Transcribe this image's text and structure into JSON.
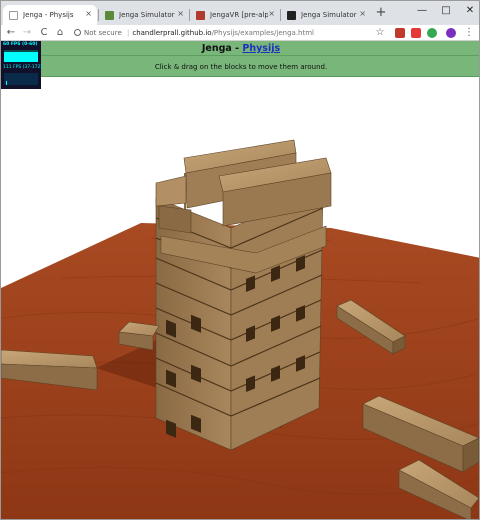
{
  "browser": {
    "tabs": [
      {
        "label": "Jenga - Physijs",
        "active": true,
        "favicon_color": "#f1f3f4"
      },
      {
        "label": "Jenga Simulator by ch",
        "active": false,
        "favicon_color": "#5b8a3c"
      },
      {
        "label": "JengaVR [pre-alpha] b",
        "active": false,
        "favicon_color": "#b03a2e"
      },
      {
        "label": "Jenga Simulator by Br",
        "active": false,
        "favicon_color": "#222222"
      }
    ],
    "close_glyph": "×",
    "new_tab_glyph": "+",
    "window_controls": {
      "minimize": "—",
      "maximize": "□",
      "close": "✕"
    },
    "nav": {
      "back": "←",
      "forward": "→",
      "reload": "C",
      "home": "⌂"
    },
    "address": {
      "security": "Not secure",
      "host": "chandlerprall.github.io",
      "path": "/Physijs/examples/jenga.html"
    },
    "star_glyph": "☆",
    "menu_glyph": "⋮",
    "extension_colors": [
      "#c0392b",
      "#e53935",
      "#34a853"
    ]
  },
  "page": {
    "title_prefix": "Jenga - ",
    "title_link": "Physijs",
    "instruction": "Click & drag on the blocks to move them around.",
    "header_color": "#78b67a"
  },
  "stats": {
    "fps_text": "60 FPS (0-60)",
    "ms_text": "111 FPS (37-172)"
  },
  "scene": {
    "table_color": "#a5441e",
    "block_color": "#a9875d",
    "background": "#ffffff"
  }
}
